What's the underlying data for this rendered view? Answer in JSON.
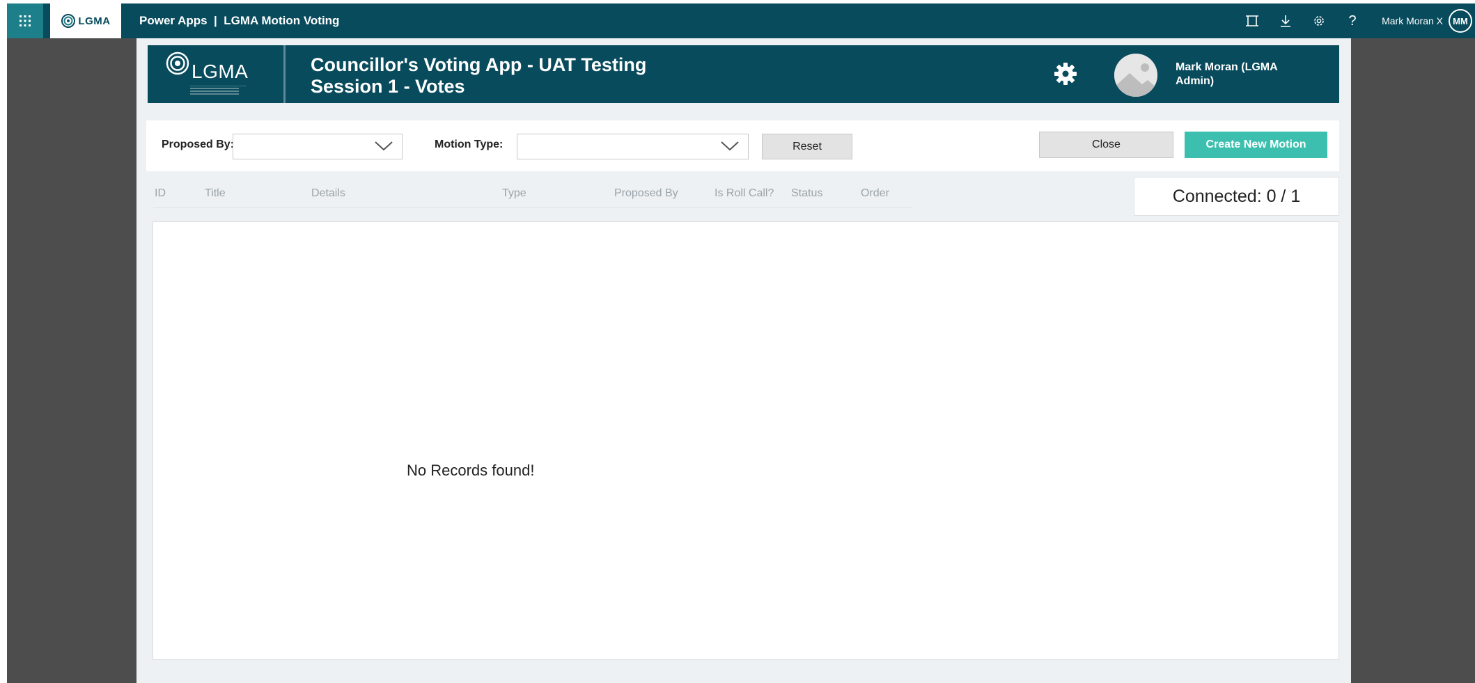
{
  "suite_bar": {
    "logo_text": "LGMA",
    "app_title": "Power Apps  |  LGMA Motion Voting",
    "icons": [
      "focus-mode-icon",
      "download-icon",
      "settings-icon",
      "help-icon"
    ],
    "help_glyph": "?",
    "user_name": "Mark Moran X",
    "user_initials": "MM"
  },
  "header": {
    "logo_text": "LGMA",
    "title_line1": "Councillor's Voting App - UAT Testing",
    "title_line2": "Session 1 - Votes",
    "user_line1": "Mark Moran (LGMA",
    "user_line2": "Admin)"
  },
  "filters": {
    "proposed_by_label": "Proposed By:",
    "proposed_by_value": "",
    "motion_type_label": "Motion Type:",
    "motion_type_value": "",
    "reset_label": "Reset",
    "close_label": "Close",
    "create_label": "Create New Motion"
  },
  "connected": "Connected: 0 / 1",
  "columns": [
    "ID",
    "Title",
    "Details",
    "Type",
    "Proposed By",
    "Is Roll Call?",
    "Status",
    "Order"
  ],
  "records": {
    "empty_message": "No Records found!"
  },
  "colors": {
    "brand_dark": "#084b5c",
    "brand_accent": "#1d7f8a",
    "primary_button": "#3cbfae",
    "gutter": "#4d4d4d",
    "canvas": "#eef1f3"
  }
}
